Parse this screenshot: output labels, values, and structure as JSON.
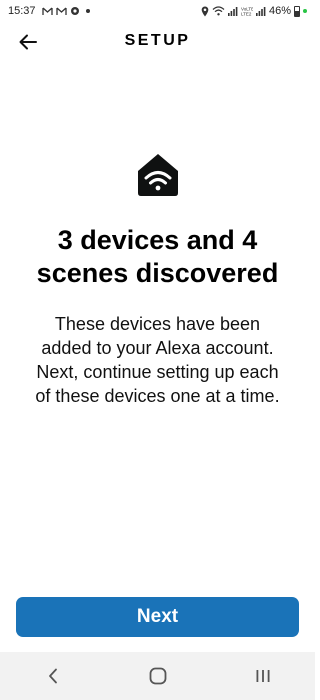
{
  "status_bar": {
    "time": "15:37",
    "battery_percent": "46%",
    "left_icons": [
      "gmail-icon",
      "gmail-icon",
      "settings-icon",
      "dot-icon"
    ],
    "right_icons": [
      "location-icon",
      "wifi-icon",
      "signal-icon",
      "volte-icon",
      "signal-icon",
      "battery-icon"
    ]
  },
  "header": {
    "title": "SETUP",
    "back_icon": "arrow-left-icon"
  },
  "main": {
    "icon": "smart-home-wifi-icon",
    "headline": "3 devices and 4 scenes discovered",
    "body": "These devices have been added to your Alexa account. Next, continue setting up each of these devices one at a time."
  },
  "footer": {
    "next_label": "Next"
  },
  "nav_bar": {
    "icons": [
      "back-chevron-icon",
      "home-circle-icon",
      "recents-icon"
    ]
  },
  "colors": {
    "primary_button": "#1a73b8",
    "battery_dot": "#28c445",
    "nav_bar_bg": "#f2f2f2"
  }
}
